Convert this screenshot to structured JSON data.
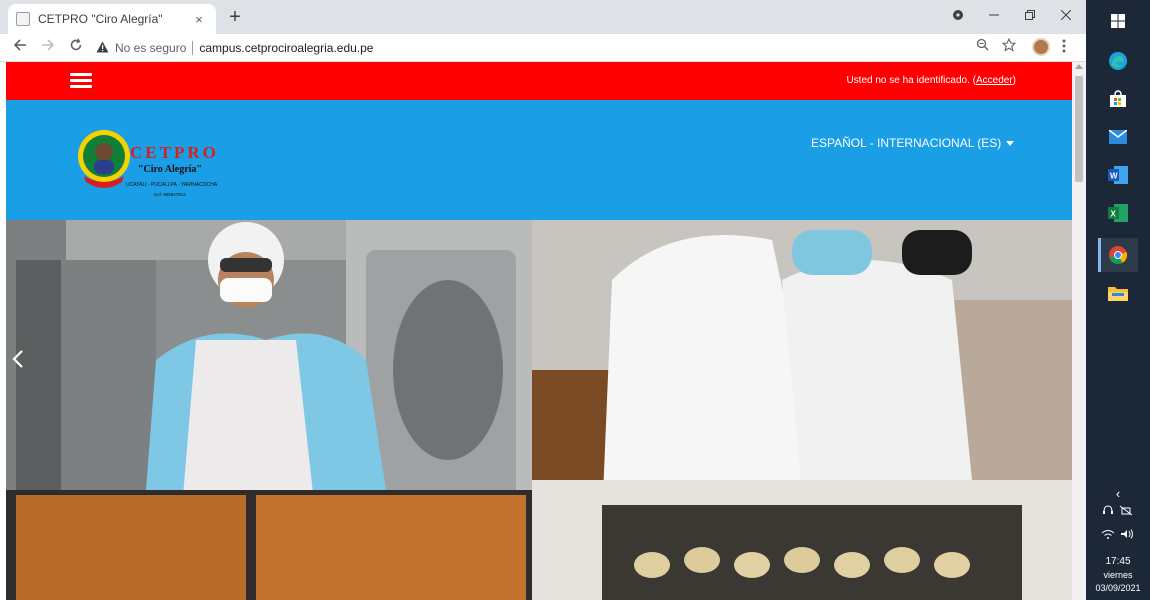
{
  "browser": {
    "tab": {
      "title": "CETPRO \"Ciro Alegría\"",
      "close": "×"
    },
    "new_tab": "+",
    "address": {
      "security_label": "No es seguro",
      "url": "campus.cetprociroalegria.edu.pe"
    }
  },
  "site": {
    "topbar": {
      "login_prefix": "Usted no se ha identificado. (",
      "login_link": "Acceder",
      "login_suffix": ")"
    },
    "logo": {
      "title": "CETPRO",
      "subtitle": "\"Ciro Alegría\"",
      "location": "UCAYALI - PUCALLPA - YARINACOCHA",
      "phone": "Cel. 965847914"
    },
    "language": "ESPAÑOL - INTERNACIONAL (ES)"
  },
  "taskbar": {
    "time": "17:45",
    "day": "viernes",
    "date": "03/09/2021",
    "expand": "‹",
    "tray_icons": [
      "headset-icon",
      "network-icon",
      "wifi-icon",
      "volume-icon"
    ]
  },
  "colors": {
    "topbar": "#ff0000",
    "header": "#1a9fe6",
    "taskbar": "#1c2837"
  }
}
